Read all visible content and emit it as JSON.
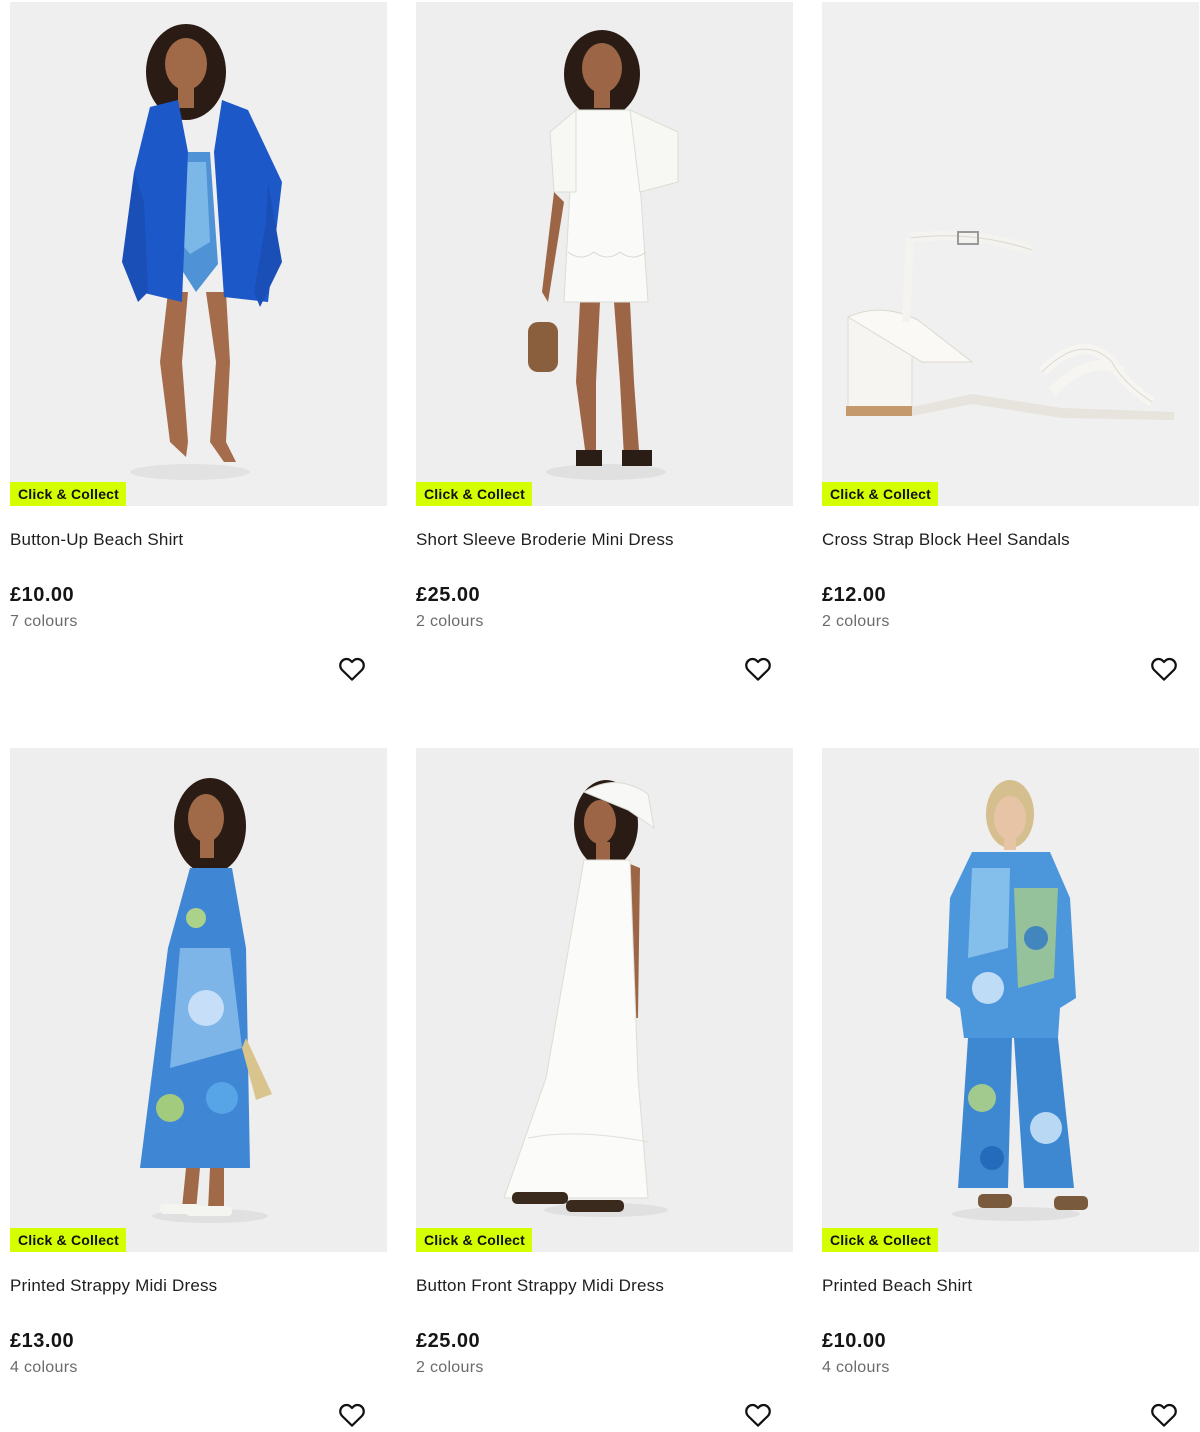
{
  "badge_color": "#d4ff00",
  "heart_icon": "heart-outline-icon",
  "products": [
    {
      "title": "Button-Up Beach Shirt",
      "price": "£10.00",
      "colours": "7 colours",
      "badge": "Click & Collect",
      "image": "model-blue-beach-shirt"
    },
    {
      "title": "Short Sleeve Broderie Mini Dress",
      "price": "£25.00",
      "colours": "2 colours",
      "badge": "Click & Collect",
      "image": "model-white-mini-dress"
    },
    {
      "title": "Cross Strap Block Heel Sandals",
      "price": "£12.00",
      "colours": "2 colours",
      "badge": "Click & Collect",
      "image": "white-block-heel-sandal"
    },
    {
      "title": "Printed Strappy Midi Dress",
      "price": "£13.00",
      "colours": "4 colours",
      "badge": "Click & Collect",
      "image": "model-printed-midi-dress"
    },
    {
      "title": "Button Front Strappy Midi Dress",
      "price": "£25.00",
      "colours": "2 colours",
      "badge": "Click & Collect",
      "image": "model-white-maxi-dress"
    },
    {
      "title": "Printed Beach Shirt",
      "price": "£10.00",
      "colours": "4 colours",
      "badge": "Click & Collect",
      "image": "model-printed-shirt-trousers"
    }
  ]
}
